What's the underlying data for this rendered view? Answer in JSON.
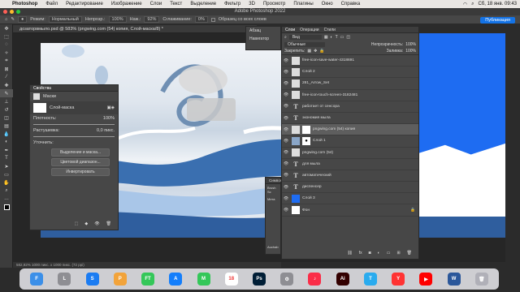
{
  "menubar": {
    "app": "Photoshop",
    "items": [
      "Файл",
      "Редактирование",
      "Изображение",
      "Слои",
      "Текст",
      "Выделение",
      "Фильтр",
      "3D",
      "Просмотр",
      "Плагины",
      "Окно",
      "Справка"
    ],
    "clock": "Сб, 18 янв. 09:43"
  },
  "window": {
    "title": "Adobe Photoshop 2022"
  },
  "options": {
    "mode_label": "Режим:",
    "mode_value": "Нормальный",
    "opacity_label": "Непрозр.:",
    "opacity_value": "100%",
    "pressure_label": "Наж.:",
    "pressure_value": "92%",
    "smoothing_label": "Сглаживание:",
    "smoothing_value": "0%",
    "all_layers": "Образец со всех слоев",
    "share_button": "Публикация"
  },
  "document": {
    "tab": "дозаторвмыло.psd @ 583% (pngwing.com (54) копия, Слой-маска/8) *",
    "status": "582,92%    1000 пикс. x 1000 пикс. (72 ppi)"
  },
  "properties": {
    "title": "Свойства",
    "mask_type": "Маски",
    "layer_mask": "Слой-маска",
    "density_label": "Плотность:",
    "density_value": "100%",
    "feather_label": "Растушевка:",
    "feather_value": "0,0 пикс.",
    "refine_label": "Уточнить:",
    "select_mask": "Выделение и маска...",
    "color_range": "Цветовой диапазон...",
    "invert": "Инвертировать"
  },
  "adjust_panel": {
    "items": [
      "Абзац",
      "Навигатор"
    ]
  },
  "symbols_panel": {
    "title": "Символ",
    "brush": "Brush Sc",
    "meta": "Мета",
    "font": "Auchab"
  },
  "layers": {
    "tabs": [
      "Слои",
      "Операции",
      "Стили"
    ],
    "search_placeholder": "Вид",
    "blend": "Обычные",
    "opacity_label": "Непрозрачность:",
    "opacity_value": "100%",
    "lock_label": "Закрепить:",
    "fill_label": "Заливка:",
    "fill_value": "100%",
    "items": [
      {
        "name": "free-icon-save-water-4318691",
        "kind": "img"
      },
      {
        "name": "Слой 2",
        "kind": "img"
      },
      {
        "name": "281_Arrow_Set",
        "kind": "img"
      },
      {
        "name": "free-icon-touch-screen-3182481",
        "kind": "img"
      },
      {
        "name": "работает от сенсора",
        "kind": "text"
      },
      {
        "name": "экономия мыла",
        "kind": "text"
      },
      {
        "name": "pngwing.com (54) копия",
        "kind": "img",
        "selected": true
      },
      {
        "name": "Слой 1",
        "kind": "mask"
      },
      {
        "name": "pngwing.com (54)",
        "kind": "img"
      },
      {
        "name": "для мыла",
        "kind": "text"
      },
      {
        "name": "автоматический",
        "kind": "text"
      },
      {
        "name": "диспенсер",
        "kind": "text"
      },
      {
        "name": "Слой 3",
        "kind": "blue"
      },
      {
        "name": "Фон",
        "kind": "white"
      }
    ],
    "footer_icons": [
      "link-icon",
      "fx-icon",
      "mask-icon",
      "adjust-icon",
      "folder-icon",
      "new-layer-icon",
      "trash-icon"
    ]
  },
  "dock": {
    "apps": [
      {
        "name": "finder-icon",
        "color": "#3b8fe8",
        "label": "F"
      },
      {
        "name": "launchpad-icon",
        "color": "#8e8e93",
        "label": "L"
      },
      {
        "name": "safari-icon",
        "color": "#1b7cf2",
        "label": "S"
      },
      {
        "name": "photos-icon",
        "color": "#f2a33a",
        "label": "P"
      },
      {
        "name": "facetime-icon",
        "color": "#34c759",
        "label": "FT"
      },
      {
        "name": "appstore-icon",
        "color": "#147efb",
        "label": "A"
      },
      {
        "name": "messages-icon",
        "color": "#34c759",
        "label": "M"
      },
      {
        "name": "calendar-icon",
        "color": "#ffffff",
        "label": "18"
      },
      {
        "name": "photoshop-icon",
        "color": "#001e36",
        "label": "Ps"
      },
      {
        "name": "settings-icon",
        "color": "#8e8e93",
        "label": "⚙"
      },
      {
        "name": "music-icon",
        "color": "#fa2d48",
        "label": "♪"
      },
      {
        "name": "illustrator-icon",
        "color": "#330000",
        "label": "Ai"
      },
      {
        "name": "telegram-icon",
        "color": "#2aabee",
        "label": "T"
      },
      {
        "name": "yandex-icon",
        "color": "#ff3333",
        "label": "Y"
      },
      {
        "name": "youtube-icon",
        "color": "#ff0000",
        "label": "▶"
      },
      {
        "name": "word-icon",
        "color": "#2b579a",
        "label": "W"
      },
      {
        "name": "trash-dock-icon",
        "color": "#b0b0b8",
        "label": "🗑"
      }
    ]
  }
}
